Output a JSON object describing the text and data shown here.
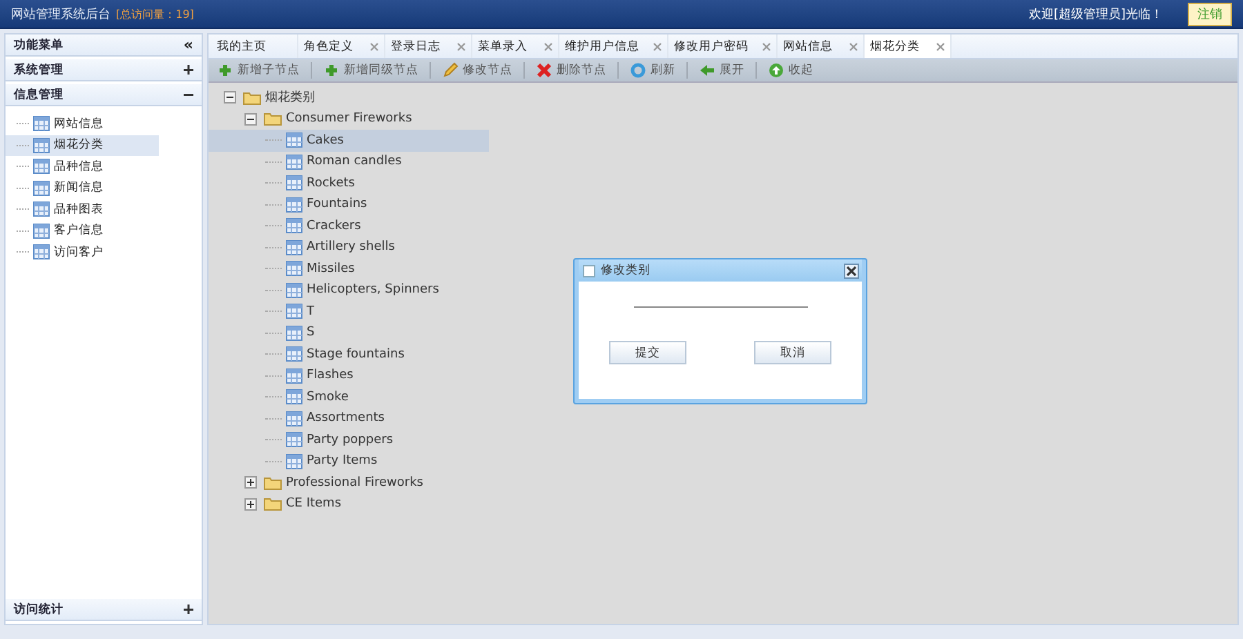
{
  "header": {
    "title": "网站管理系统后台",
    "visits": "[总访问量：19]",
    "welcome": "欢迎[超级管理员]光临！",
    "logout": "注销"
  },
  "sidebar": {
    "title": "功能菜单",
    "collapse": "«",
    "groups": [
      {
        "label": "系统管理",
        "expanded": false
      },
      {
        "label": "信息管理",
        "expanded": true,
        "items": [
          {
            "label": "网站信息",
            "selected": false
          },
          {
            "label": "烟花分类",
            "selected": true
          },
          {
            "label": "品种信息",
            "selected": false
          },
          {
            "label": "新闻信息",
            "selected": false
          },
          {
            "label": "品种图表",
            "selected": false
          },
          {
            "label": "客户信息",
            "selected": false
          },
          {
            "label": "访问客户",
            "selected": false
          }
        ]
      }
    ],
    "bottom_group": {
      "label": "访问统计",
      "expanded": false
    }
  },
  "tabs": [
    {
      "label": "我的主页",
      "selected": false,
      "closable": false
    },
    {
      "label": "角色定义",
      "selected": false,
      "closable": true
    },
    {
      "label": "登录日志",
      "selected": false,
      "closable": true
    },
    {
      "label": "菜单录入",
      "selected": false,
      "closable": true
    },
    {
      "label": "维护用户信息",
      "selected": false,
      "closable": true
    },
    {
      "label": "修改用户密码",
      "selected": false,
      "closable": true
    },
    {
      "label": "网站信息",
      "selected": false,
      "closable": true
    },
    {
      "label": "烟花分类",
      "selected": true,
      "closable": true
    }
  ],
  "toolbar": [
    {
      "label": "新增子节点",
      "kind": "add"
    },
    {
      "label": "新增同级节点",
      "kind": "add"
    },
    {
      "label": "修改节点",
      "kind": "edit"
    },
    {
      "label": "删除节点",
      "kind": "delete"
    },
    {
      "label": "刷新",
      "kind": "refresh"
    },
    {
      "label": "展开",
      "kind": "expand"
    },
    {
      "label": "收起",
      "kind": "collapse"
    }
  ],
  "tree": [
    {
      "label": "烟花类别",
      "kind": "folder",
      "expanded": true,
      "selected": false,
      "children": [
        {
          "label": "Consumer Fireworks",
          "kind": "folder",
          "expanded": true,
          "selected": false,
          "children": [
            {
              "label": "Cakes",
              "kind": "leaf",
              "selected": true
            },
            {
              "label": "Roman candles",
              "kind": "leaf",
              "selected": false
            },
            {
              "label": "Rockets",
              "kind": "leaf",
              "selected": false
            },
            {
              "label": "Fountains",
              "kind": "leaf",
              "selected": false
            },
            {
              "label": "Crackers",
              "kind": "leaf",
              "selected": false
            },
            {
              "label": "Artillery shells",
              "kind": "leaf",
              "selected": false
            },
            {
              "label": "Missiles",
              "kind": "leaf",
              "selected": false
            },
            {
              "label": "Helicopters, Spinners",
              "kind": "leaf",
              "selected": false
            },
            {
              "label": "T",
              "kind": "leaf",
              "selected": false
            },
            {
              "label": "S",
              "kind": "leaf",
              "selected": false
            },
            {
              "label": "Stage fountains",
              "kind": "leaf",
              "selected": false
            },
            {
              "label": "Flashes",
              "kind": "leaf",
              "selected": false
            },
            {
              "label": "Smoke",
              "kind": "leaf",
              "selected": false
            },
            {
              "label": "Assortments",
              "kind": "leaf",
              "selected": false
            },
            {
              "label": "Party poppers",
              "kind": "leaf",
              "selected": false
            },
            {
              "label": "Party Items",
              "kind": "leaf",
              "selected": false
            }
          ]
        },
        {
          "label": "Professional Fireworks",
          "kind": "folder",
          "expanded": false,
          "selected": false
        },
        {
          "label": "CE Items",
          "kind": "folder",
          "expanded": false,
          "selected": false
        }
      ]
    }
  ],
  "dialog": {
    "title": "修改类别",
    "buttons": [
      "提交",
      "取消"
    ]
  }
}
